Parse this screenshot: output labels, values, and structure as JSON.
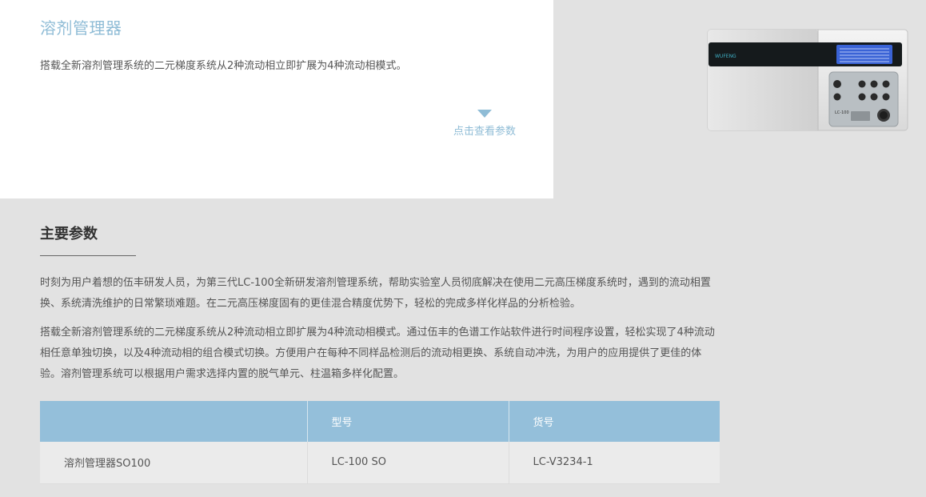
{
  "intro": {
    "title": "溶剂管理器",
    "description": "搭载全新溶剂管理系统的二元梯度系统从2种流动相立即扩展为4种流动相模式。",
    "more_label": "点击查看参数"
  },
  "device": {
    "brand": "WUFENG",
    "model_label": "LC-100"
  },
  "params": {
    "title": "主要参数",
    "paragraphs": [
      "时刻为用户着想的伍丰研发人员，为第三代LC-100全新研发溶剂管理系统，帮助实验室人员彻底解决在使用二元高压梯度系统时，遇到的流动相置换、系统清洗维护的日常繁琐难题。在二元高压梯度固有的更佳混合精度优势下，轻松的完成多样化样品的分析检验。",
      "搭载全新溶剂管理系统的二元梯度系统从2种流动相立即扩展为4种流动相模式。通过伍丰的色谱工作站软件进行时间程序设置，轻松实现了4种流动相任意单独切换，以及4种流动相的组合模式切换。方便用户在每种不同样品检测后的流动相更换、系统自动冲洗，为用户的应用提供了更佳的体验。溶剂管理系统可以根据用户需求选择内置的脱气单元、柱温箱多样化配置。"
    ]
  },
  "table": {
    "headers": [
      "",
      "型号",
      "货号"
    ],
    "rows": [
      [
        "溶剂管理器SO100",
        "LC-100 SO",
        "LC-V3234-1"
      ]
    ]
  },
  "colors": {
    "accent": "#8fbcd6",
    "table_header": "#94bfda",
    "background": "#e2e2e2"
  }
}
